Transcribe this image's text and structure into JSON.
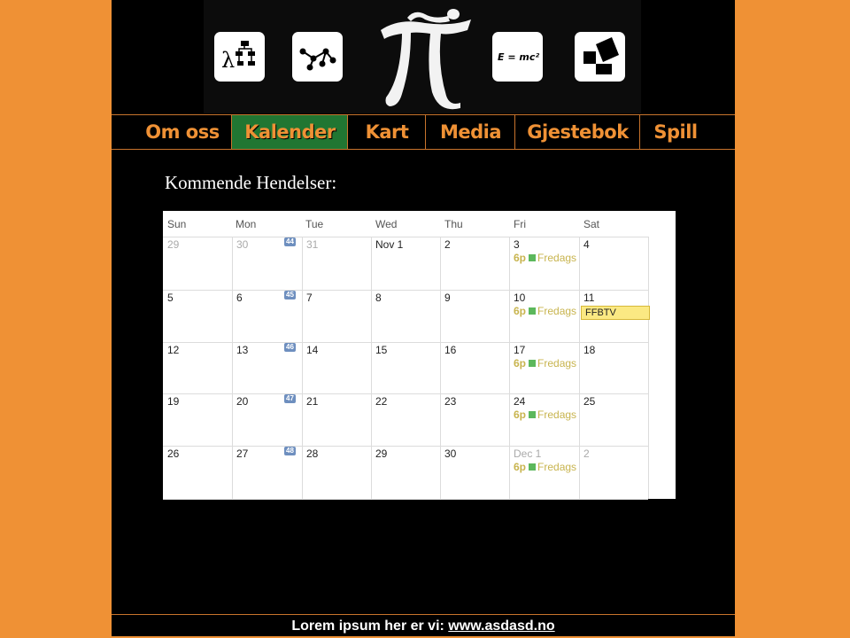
{
  "banner": {
    "icons": [
      "lambda-flowchart-icon",
      "graph-nodes-icon",
      "pi-figure-logo",
      "emc2-icon",
      "pythagoras-icon"
    ],
    "emc2_text": "E = mc²",
    "lambda_text": "λ"
  },
  "nav": {
    "items": [
      "Om oss",
      "Kalender",
      "Kart",
      "Media",
      "Gjestebok",
      "Spill"
    ],
    "active": "Kalender"
  },
  "heading": "Kommende Hendelser:",
  "calendar": {
    "weekdays": [
      "Sun",
      "Mon",
      "Tue",
      "Wed",
      "Thu",
      "Fri",
      "Sat"
    ],
    "weeks": [
      {
        "week_no": "44",
        "days": [
          "29",
          "30",
          "31",
          "Nov 1",
          "2",
          "3",
          "4"
        ],
        "muted": [
          true,
          true,
          true,
          false,
          false,
          false,
          false
        ]
      },
      {
        "week_no": "45",
        "days": [
          "5",
          "6",
          "7",
          "8",
          "9",
          "10",
          "11"
        ],
        "muted": [
          false,
          false,
          false,
          false,
          false,
          false,
          false
        ]
      },
      {
        "week_no": "46",
        "days": [
          "12",
          "13",
          "14",
          "15",
          "16",
          "17",
          "18"
        ],
        "muted": [
          false,
          false,
          false,
          false,
          false,
          false,
          false
        ]
      },
      {
        "week_no": "47",
        "days": [
          "19",
          "20",
          "21",
          "22",
          "23",
          "24",
          "25"
        ],
        "muted": [
          false,
          false,
          false,
          false,
          false,
          false,
          false
        ]
      },
      {
        "week_no": "48",
        "days": [
          "26",
          "27",
          "28",
          "29",
          "30",
          "Dec 1",
          "2"
        ],
        "muted": [
          false,
          false,
          false,
          false,
          false,
          true,
          true
        ]
      }
    ],
    "friday_event": {
      "time": "6p",
      "title": "Fredags"
    },
    "allday_event": {
      "title": "FFBTV"
    }
  },
  "footer": {
    "text": "Lorem ipsum her er vi: ",
    "link": "www.asdasd.no"
  },
  "colors": {
    "background": "#ef9135",
    "nav_active": "#217632",
    "event_text": "#c8b44e",
    "event_dot": "#5cb85c",
    "allday_bg": "#fbe983"
  }
}
